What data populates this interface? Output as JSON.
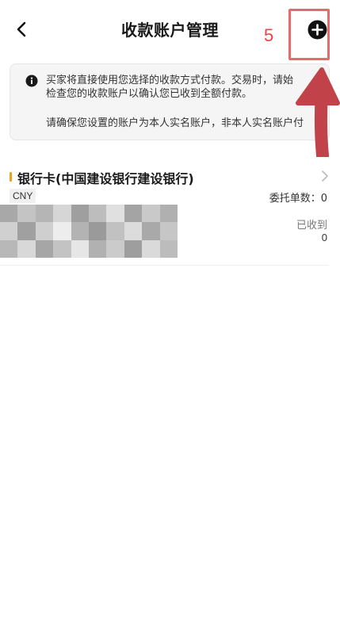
{
  "header": {
    "title": "收款账户管理",
    "back_icon": "chevron-left-icon",
    "add_icon": "plus-circle-icon"
  },
  "annotation": {
    "step_number": "5",
    "color": "#e64545"
  },
  "notice": {
    "icon": "info-icon",
    "line1": "买家将直接使用您选择的收款方式付款。交易时，请始",
    "line2": "检查您的收款账户以确认您已收到全额付款。",
    "line3": "请确保您设置的账户为本人实名账户，非本人实名账户付"
  },
  "accounts": [
    {
      "title": "银行卡(中国建设银行建设银行)",
      "currency": "CNY",
      "orders_label": "委托单数：0",
      "received_label": "已收到",
      "received_value": "0",
      "accent_color": "#f0a020"
    }
  ]
}
